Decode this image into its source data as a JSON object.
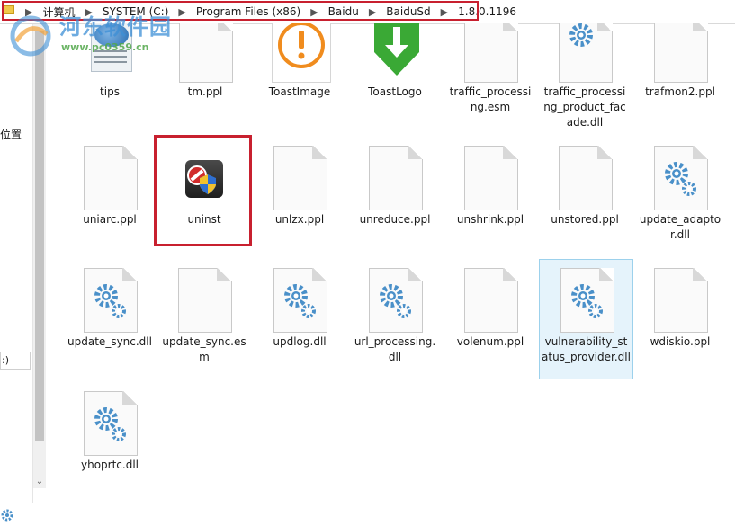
{
  "address_bar": {
    "crumbs": [
      "计算机",
      "SYSTEM (C:)",
      "Program Files (x86)",
      "Baidu",
      "BaiduSd",
      "1.8.0.1196"
    ],
    "separator": "▶"
  },
  "watermark": {
    "text": "河东软件园",
    "url": "www.pc0359.cn"
  },
  "nav": {
    "location_label": "位置",
    "drive_label": ":)"
  },
  "files": [
    {
      "name": "tips",
      "icon": "tips-icon"
    },
    {
      "name": "tm.ppl",
      "icon": "document-icon"
    },
    {
      "name": "ToastImage",
      "icon": "toast-image-icon"
    },
    {
      "name": "ToastLogo",
      "icon": "toast-logo-icon"
    },
    {
      "name": "traffic_processing.esm",
      "icon": "document-icon"
    },
    {
      "name": "traffic_processing_product_facade.dll",
      "icon": "dll-gear-icon"
    },
    {
      "name": "trafmon2.ppl",
      "icon": "document-icon"
    },
    {
      "name": "uniarc.ppl",
      "icon": "document-icon"
    },
    {
      "name": "uninst",
      "icon": "uninstall-shield-icon"
    },
    {
      "name": "unlzx.ppl",
      "icon": "document-icon"
    },
    {
      "name": "unreduce.ppl",
      "icon": "document-icon"
    },
    {
      "name": "unshrink.ppl",
      "icon": "document-icon"
    },
    {
      "name": "unstored.ppl",
      "icon": "document-icon"
    },
    {
      "name": "update_adaptor.dll",
      "icon": "dll-gear-icon"
    },
    {
      "name": "update_sync.dll",
      "icon": "dll-gear-icon"
    },
    {
      "name": "update_sync.esm",
      "icon": "document-icon"
    },
    {
      "name": "updlog.dll",
      "icon": "dll-gear-icon"
    },
    {
      "name": "url_processing.dll",
      "icon": "dll-gear-icon"
    },
    {
      "name": "volenum.ppl",
      "icon": "document-icon"
    },
    {
      "name": "vulnerability_status_provider.dll",
      "icon": "dll-gear-icon"
    },
    {
      "name": "wdiskio.ppl",
      "icon": "document-icon"
    },
    {
      "name": "yhoprtc.dll",
      "icon": "dll-gear-icon"
    }
  ],
  "selected_file": "vulnerability_status_provider.dll",
  "highlighted_file": "uninst",
  "colors": {
    "highlight_red": "#c8202f",
    "selection_fill": "#e5f3fb",
    "selection_border": "#9cd1ec",
    "toast_orange": "#f08c1e",
    "toast_green": "#3aa935",
    "gear_blue": "#4a90c9"
  }
}
